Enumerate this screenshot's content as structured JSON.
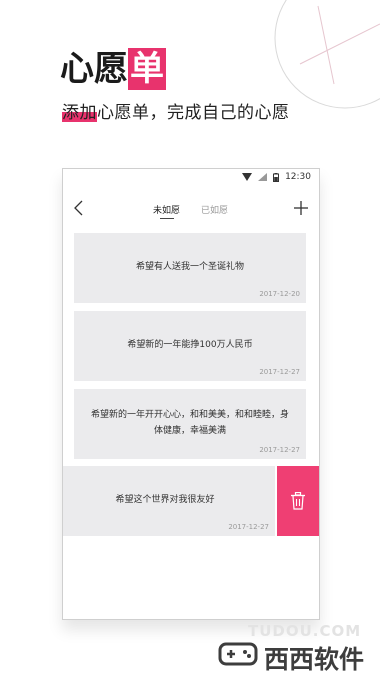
{
  "promo": {
    "title_plain": "心愿",
    "title_accent": "单",
    "subtitle_highlight": "添加",
    "subtitle_rest": "心愿单，完成自己的心愿"
  },
  "status_bar": {
    "time": "12:30"
  },
  "nav": {
    "tabs": [
      {
        "label": "未如愿",
        "active": true
      },
      {
        "label": "已如愿",
        "active": false
      }
    ]
  },
  "wishes": [
    {
      "text": "希望有人送我一个圣诞礼物",
      "date": "2017-12-20"
    },
    {
      "text": "希望新的一年能挣100万人民币",
      "date": "2017-12-27"
    },
    {
      "text": "希望新的一年开开心心，和和美美，和和睦睦，身体健康，幸福美满",
      "date": "2017-12-27"
    },
    {
      "text": "希望这个世界对我很友好",
      "date": "2017-12-27"
    }
  ],
  "watermark": {
    "site": "TUDOU.COM",
    "text": "西西软件"
  },
  "colors": {
    "accent": "#e8336d",
    "delete": "#ef3f73",
    "card_bg": "#ebebed"
  }
}
